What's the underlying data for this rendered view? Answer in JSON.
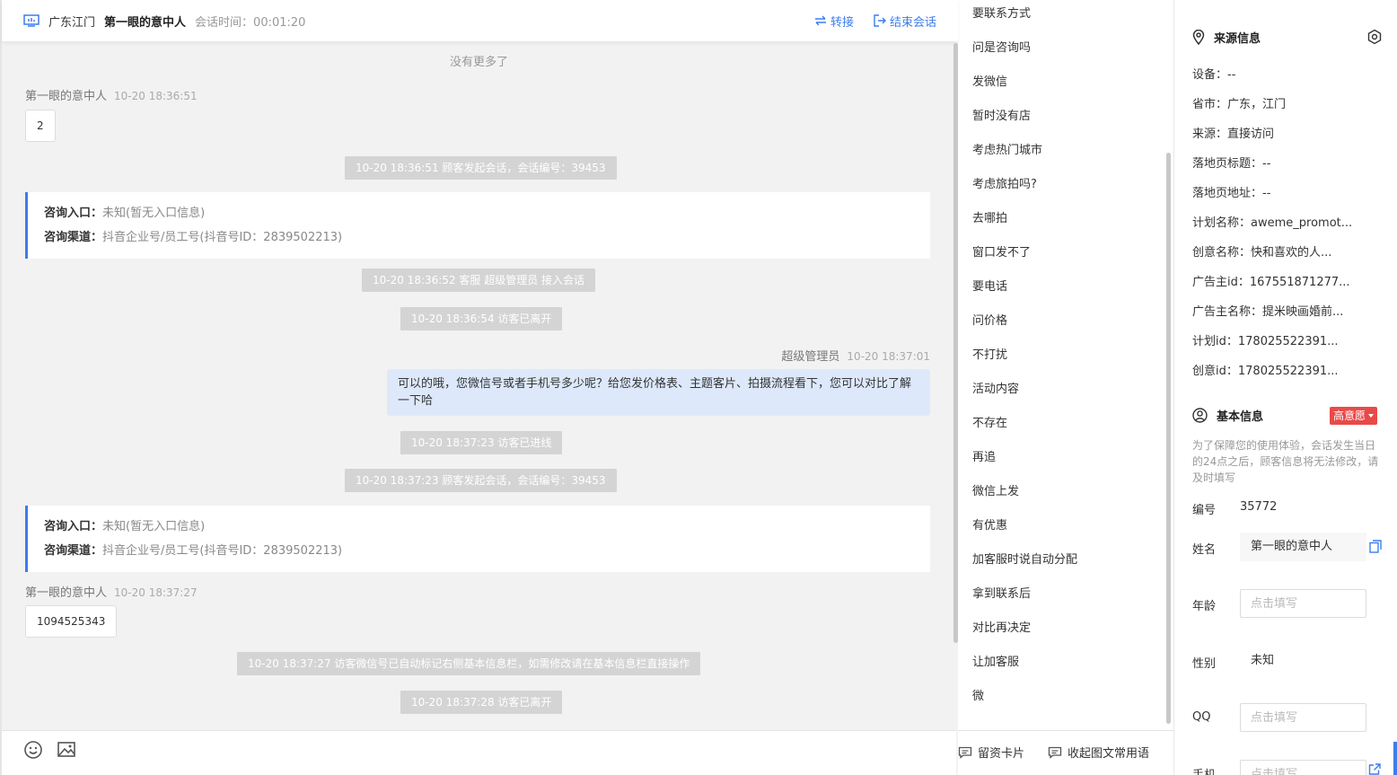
{
  "header": {
    "region": "广东江门",
    "visitor_name": "第一眼的意中人",
    "session_label": "会话时间：",
    "session_time": "00:01:20",
    "transfer_label": "转接",
    "end_label": "结束会话"
  },
  "chat": {
    "no_more": "没有更多了",
    "m1": {
      "sender": "第一眼的意中人",
      "time": "10-20 18:36:51",
      "text": "2"
    },
    "s1": "10-20 18:36:51 顾客发起会话，会话编号：39453",
    "card1": {
      "entry_label": "咨询入口：",
      "entry_value": "未知(暂无入口信息)",
      "channel_label": "咨询渠道：",
      "channel_value": "抖音企业号/员工号(抖音号ID：2839502213)"
    },
    "s2": "10-20 18:36:52 客服 超级管理员 接入会话",
    "s3": "10-20 18:36:54 访客已离开",
    "m2": {
      "sender": "超级管理员",
      "time": "10-20 18:37:01",
      "text": "可以的哦，您微信号或者手机号多少呢？给您发价格表、主题客片、拍摄流程看下，您可以对比了解一下哈"
    },
    "s4": "10-20 18:37:23 访客已进线",
    "s5": "10-20 18:37:23 顾客发起会话，会话编号：39453",
    "card2": {
      "entry_label": "咨询入口：",
      "entry_value": "未知(暂无入口信息)",
      "channel_label": "咨询渠道：",
      "channel_value": "抖音企业号/员工号(抖音号ID：2839502213)"
    },
    "m3": {
      "sender": "第一眼的意中人",
      "time": "10-20 18:37:27",
      "text": "1094525343"
    },
    "s6": "10-20 18:37:27 访客微信号已自动标记右侧基本信息栏，如需修改请在基本信息栏直接操作",
    "s7": "10-20 18:37:28 访客已离开"
  },
  "quick_replies": [
    "要联系方式",
    "问是咨询吗",
    "发微信",
    "暂时没有店",
    "考虑热门城市",
    "考虑旅拍吗?",
    "去哪拍",
    "窗口发不了",
    "要电话",
    "问价格",
    "不打扰",
    "活动内容",
    "不存在",
    "再追",
    "微信上发",
    "有优惠",
    "加客服时说自动分配",
    "拿到联系后",
    "对比再决定",
    "让加客服",
    "微"
  ],
  "quick_footer": {
    "card_label": "留资卡片",
    "collapse_label": "收起图文常用语"
  },
  "source_info": {
    "title": "来源信息",
    "rows": [
      {
        "k": "设备：",
        "v": "--"
      },
      {
        "k": "省市：",
        "v": "广东，江门"
      },
      {
        "k": "来源：",
        "v": "直接访问"
      },
      {
        "k": "落地页标题：",
        "v": "--"
      },
      {
        "k": "落地页地址：",
        "v": "--"
      },
      {
        "k": "计划名称：",
        "v": "aweme_promot..."
      },
      {
        "k": "创意名称：",
        "v": "快和喜欢的人..."
      },
      {
        "k": "广告主id：",
        "v": "167551871277..."
      },
      {
        "k": "广告主名称：",
        "v": "提米映画婚前..."
      },
      {
        "k": "计划id：",
        "v": "178025522391..."
      },
      {
        "k": "创意id：",
        "v": "178025522391..."
      }
    ]
  },
  "basic_info": {
    "title": "基本信息",
    "badge": "高意愿",
    "note": "为了保障您的使用体验，会话发生当日的24点之后，顾客信息将无法修改，请及时填写",
    "id_label": "编号",
    "id_value": "35772",
    "name_label": "姓名",
    "name_value": "第一眼的意中人",
    "age_label": "年龄",
    "age_placeholder": "点击填写",
    "gender_label": "性别",
    "gender_value": "未知",
    "qq_label": "QQ",
    "qq_placeholder": "点击填写",
    "phone_label": "手机",
    "phone_placeholder": "点击填写"
  },
  "colors": {
    "accent": "#3b7ded",
    "badge": "#e84a48",
    "agent_bubble": "#dde9fb",
    "system_bubble": "#d4d4d4"
  }
}
